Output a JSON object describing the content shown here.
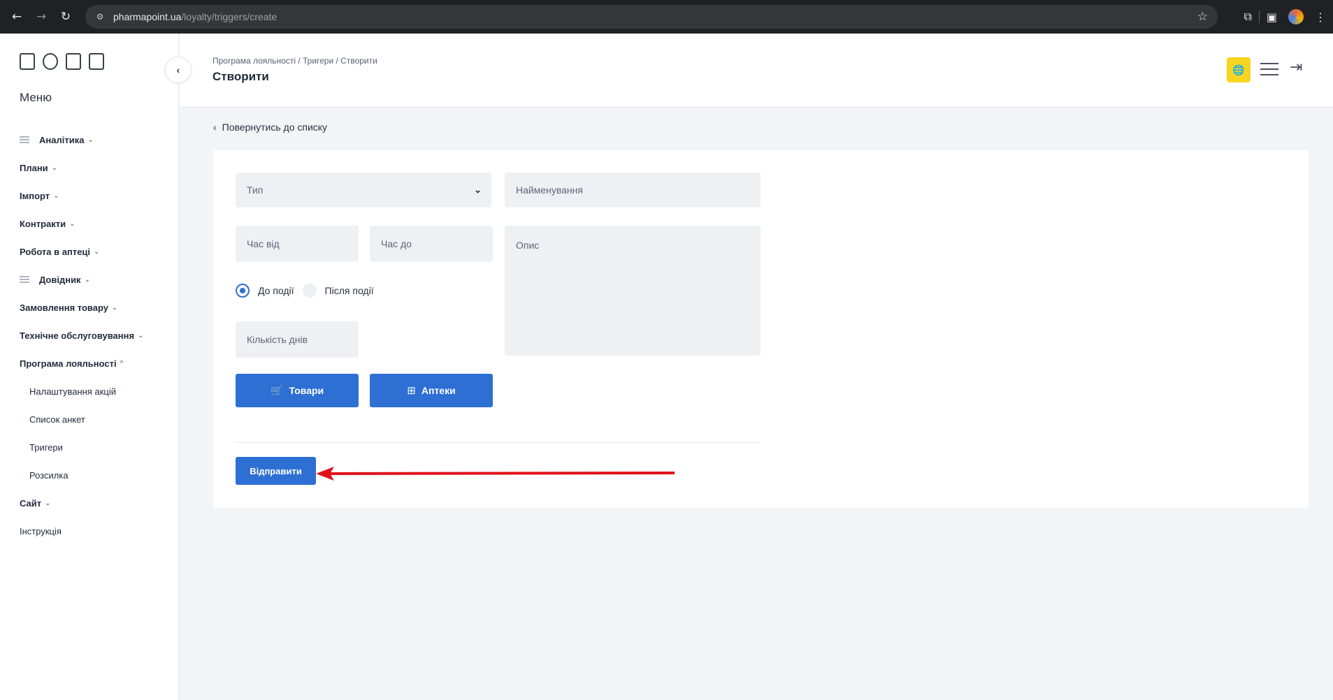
{
  "browser": {
    "url_host": "pharmapoint.ua",
    "url_path": "/loyalty/triggers/create"
  },
  "sidebar": {
    "menu_title": "Меню",
    "items": [
      {
        "label": "Аналітика",
        "caret": "⌄"
      },
      {
        "label": "Плани",
        "caret": "⌄"
      },
      {
        "label": "Імпорт",
        "caret": "⌄"
      },
      {
        "label": "Контракти",
        "caret": "⌄"
      },
      {
        "label": "Робота в аптеці",
        "caret": "⌄"
      },
      {
        "label": "Довідник",
        "caret": "⌄"
      },
      {
        "label": "Замовлення товару",
        "caret": "⌄"
      },
      {
        "label": "Технічне обслуговування",
        "caret": "⌄"
      },
      {
        "label": "Програма лояльності",
        "caret": "^"
      },
      {
        "label": "Налаштування акцій"
      },
      {
        "label": "Список анкет"
      },
      {
        "label": "Тригери"
      },
      {
        "label": "Розсилка"
      },
      {
        "label": "Сайт",
        "caret": "⌄"
      },
      {
        "label": "Інструкція"
      }
    ]
  },
  "header": {
    "breadcrumb": "Програма лояльності / Тригери / Створити",
    "title": "Створити"
  },
  "content": {
    "back_link": "Повернутись до списку",
    "form": {
      "type_placeholder": "Тип",
      "name_placeholder": "Найменування",
      "time_from_placeholder": "Час від",
      "time_to_placeholder": "Час до",
      "description_placeholder": "Опис",
      "radio_before": "До події",
      "radio_after": "Після події",
      "radio_selected": "До події",
      "days_placeholder": "Кількість днів",
      "goods_button": "Товари",
      "pharmacies_button": "Аптеки",
      "submit_button": "Відправити"
    }
  },
  "colors": {
    "accent": "#2e6fd4",
    "lang_button": "#f7d51e",
    "annotation_arrow": "#e0101a"
  }
}
